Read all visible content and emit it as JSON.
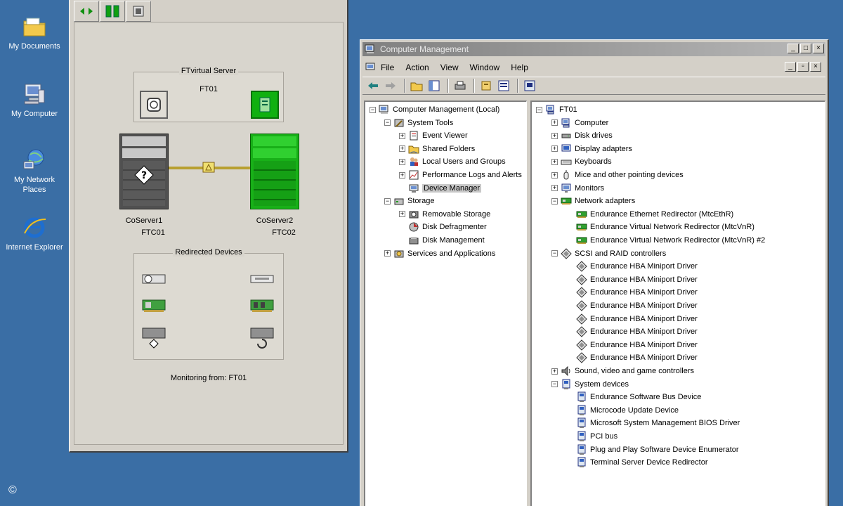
{
  "desktop": {
    "icons": [
      {
        "label": "My Documents",
        "icon": "folder-icon"
      },
      {
        "label": "My Computer",
        "icon": "computer-icon"
      },
      {
        "label": "My Network Places",
        "icon": "network-icon"
      },
      {
        "label": "Internet Explorer",
        "icon": "ie-icon"
      }
    ],
    "copyright": "©"
  },
  "ft_window": {
    "virtual_server": {
      "title": "FTvirtual Server",
      "name": "FT01"
    },
    "servers": [
      {
        "name": "CoServer1",
        "id": "FTC01"
      },
      {
        "name": "CoServer2",
        "id": "FTC02"
      }
    ],
    "redirected_devices_title": "Redirected Devices",
    "monitoring_text": "Monitoring from: FT01"
  },
  "cm_window": {
    "title": "Computer Management",
    "menu": [
      "File",
      "Action",
      "View",
      "Window",
      "Help"
    ],
    "left_tree": [
      {
        "label": "Computer Management (Local)",
        "level": 0,
        "expander": "minus",
        "icon": "computer-mgmt-icon"
      },
      {
        "label": "System Tools",
        "level": 1,
        "expander": "minus",
        "icon": "system-tools-icon"
      },
      {
        "label": "Event Viewer",
        "level": 2,
        "expander": "plus",
        "icon": "event-viewer-icon"
      },
      {
        "label": "Shared Folders",
        "level": 2,
        "expander": "plus",
        "icon": "shared-folders-icon"
      },
      {
        "label": "Local Users and Groups",
        "level": 2,
        "expander": "plus",
        "icon": "users-icon"
      },
      {
        "label": "Performance Logs and Alerts",
        "level": 2,
        "expander": "plus",
        "icon": "perf-logs-icon"
      },
      {
        "label": "Device Manager",
        "level": 2,
        "expander": "none",
        "icon": "device-manager-icon",
        "selected": true
      },
      {
        "label": "Storage",
        "level": 1,
        "expander": "minus",
        "icon": "storage-icon"
      },
      {
        "label": "Removable Storage",
        "level": 2,
        "expander": "plus",
        "icon": "removable-storage-icon"
      },
      {
        "label": "Disk Defragmenter",
        "level": 2,
        "expander": "none",
        "icon": "defrag-icon"
      },
      {
        "label": "Disk Management",
        "level": 2,
        "expander": "none",
        "icon": "disk-mgmt-icon"
      },
      {
        "label": "Services and Applications",
        "level": 1,
        "expander": "plus",
        "icon": "services-icon"
      }
    ],
    "right_tree": [
      {
        "label": "FT01",
        "level": 0,
        "expander": "minus",
        "icon": "computer-icon"
      },
      {
        "label": "Computer",
        "level": 1,
        "expander": "plus",
        "icon": "computer-icon"
      },
      {
        "label": "Disk drives",
        "level": 1,
        "expander": "plus",
        "icon": "disk-icon"
      },
      {
        "label": "Display adapters",
        "level": 1,
        "expander": "plus",
        "icon": "display-icon"
      },
      {
        "label": "Keyboards",
        "level": 1,
        "expander": "plus",
        "icon": "keyboard-icon"
      },
      {
        "label": "Mice and other pointing devices",
        "level": 1,
        "expander": "plus",
        "icon": "mouse-icon"
      },
      {
        "label": "Monitors",
        "level": 1,
        "expander": "plus",
        "icon": "monitor-icon"
      },
      {
        "label": "Network adapters",
        "level": 1,
        "expander": "minus",
        "icon": "network-adapter-icon"
      },
      {
        "label": "Endurance Ethernet Redirector (MtcEthR)",
        "level": 2,
        "expander": "none",
        "icon": "network-adapter-icon"
      },
      {
        "label": "Endurance Virtual Network Redirector (MtcVnR)",
        "level": 2,
        "expander": "none",
        "icon": "network-adapter-icon"
      },
      {
        "label": "Endurance Virtual Network Redirector (MtcVnR) #2",
        "level": 2,
        "expander": "none",
        "icon": "network-adapter-icon"
      },
      {
        "label": "SCSI and RAID controllers",
        "level": 1,
        "expander": "minus",
        "icon": "scsi-icon"
      },
      {
        "label": "Endurance HBA Miniport Driver",
        "level": 2,
        "expander": "none",
        "icon": "scsi-icon"
      },
      {
        "label": "Endurance HBA Miniport Driver",
        "level": 2,
        "expander": "none",
        "icon": "scsi-icon"
      },
      {
        "label": "Endurance HBA Miniport Driver",
        "level": 2,
        "expander": "none",
        "icon": "scsi-icon"
      },
      {
        "label": "Endurance HBA Miniport Driver",
        "level": 2,
        "expander": "none",
        "icon": "scsi-icon"
      },
      {
        "label": "Endurance HBA Miniport Driver",
        "level": 2,
        "expander": "none",
        "icon": "scsi-icon"
      },
      {
        "label": "Endurance HBA Miniport Driver",
        "level": 2,
        "expander": "none",
        "icon": "scsi-icon"
      },
      {
        "label": "Endurance HBA Miniport Driver",
        "level": 2,
        "expander": "none",
        "icon": "scsi-icon"
      },
      {
        "label": "Endurance HBA Miniport Driver",
        "level": 2,
        "expander": "none",
        "icon": "scsi-icon"
      },
      {
        "label": "Sound, video and game controllers",
        "level": 1,
        "expander": "plus",
        "icon": "sound-icon"
      },
      {
        "label": "System devices",
        "level": 1,
        "expander": "minus",
        "icon": "system-device-icon"
      },
      {
        "label": "Endurance Software Bus Device",
        "level": 2,
        "expander": "none",
        "icon": "system-device-icon"
      },
      {
        "label": "Microcode Update Device",
        "level": 2,
        "expander": "none",
        "icon": "system-device-icon"
      },
      {
        "label": "Microsoft System Management BIOS Driver",
        "level": 2,
        "expander": "none",
        "icon": "system-device-icon"
      },
      {
        "label": "PCI bus",
        "level": 2,
        "expander": "none",
        "icon": "system-device-icon"
      },
      {
        "label": "Plug and Play Software Device Enumerator",
        "level": 2,
        "expander": "none",
        "icon": "system-device-icon"
      },
      {
        "label": "Terminal Server Device Redirector",
        "level": 2,
        "expander": "none",
        "icon": "system-device-icon"
      }
    ],
    "colors": {
      "title_inactive": "#808080",
      "selection": "#c8c8c8",
      "ft_green": "#10b010",
      "desktop": "#3a6ea5"
    }
  }
}
